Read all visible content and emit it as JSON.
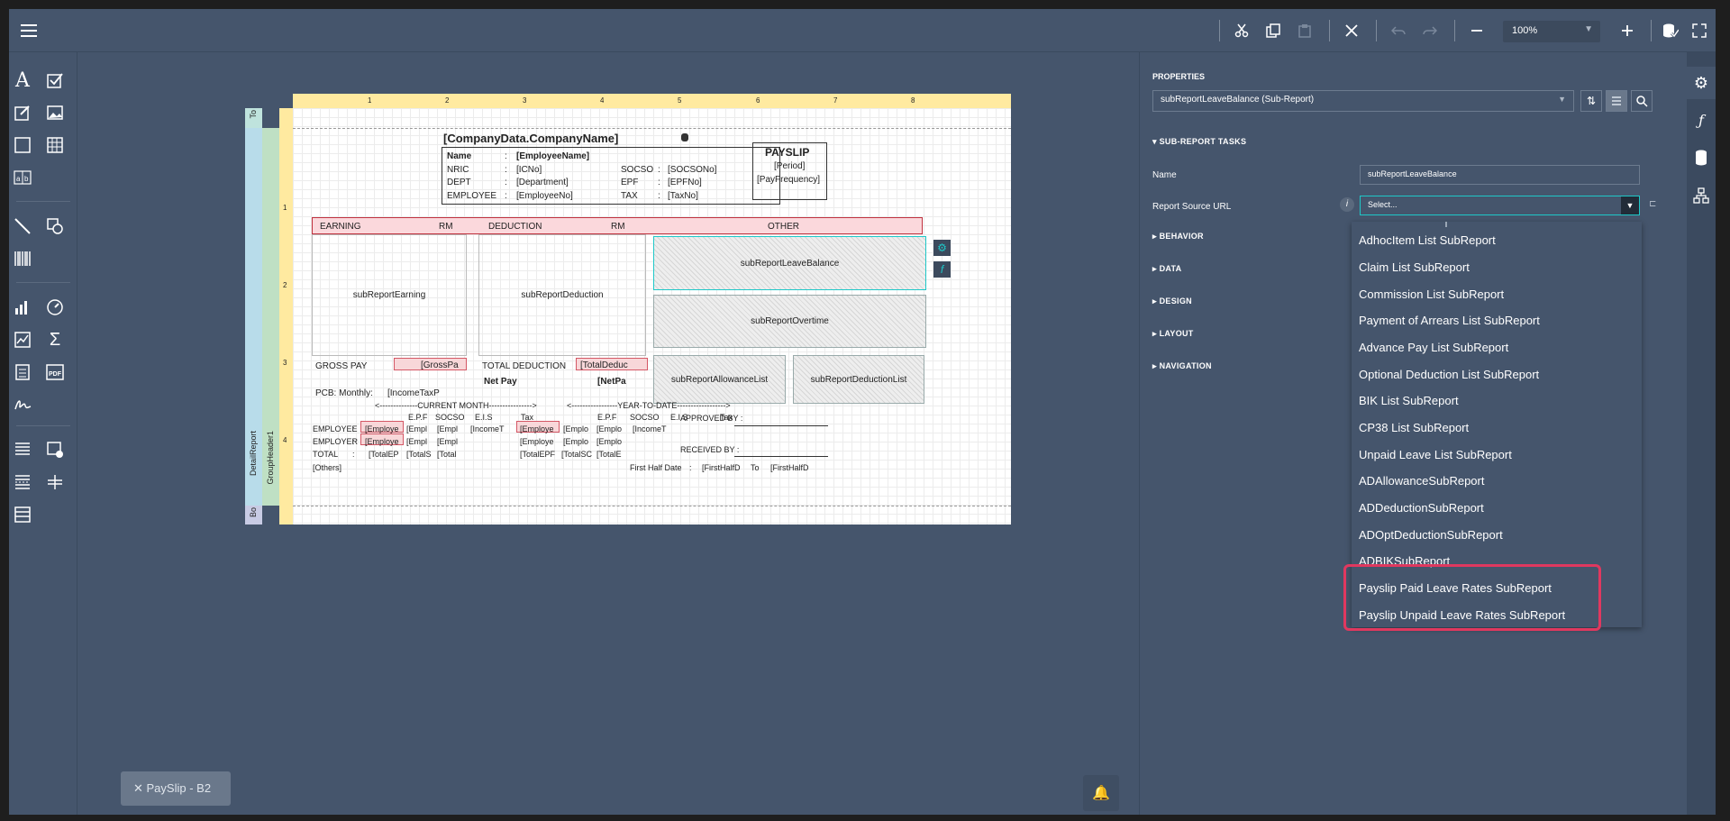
{
  "toolbar": {
    "zoom": "100%"
  },
  "report": {
    "company": "[CompanyData.CompanyName]",
    "payslip_title": "PAYSLIP",
    "period": "[Period]",
    "pay_frequency": "[PayFrequency]",
    "info_rows": [
      {
        "label": "Name",
        "colon": ":",
        "value": "[EmployeeName]"
      },
      {
        "label": "NRIC",
        "colon": ":",
        "value": "[ICNo]"
      },
      {
        "label": "DEPT",
        "colon": ":",
        "value": "[Department]"
      },
      {
        "label": "EMPLOYEE",
        "colon": ":",
        "value": "[EmployeeNo]"
      }
    ],
    "stat_rows": [
      {
        "label": "SOCSO",
        "colon": ":",
        "value": "[SOCSONo]"
      },
      {
        "label": "EPF",
        "colon": ":",
        "value": "[EPFNo]"
      },
      {
        "label": "TAX",
        "colon": ":",
        "value": "[TaxNo]"
      }
    ],
    "headers": {
      "earning": "EARNING",
      "rm1": "RM",
      "deduction": "DEDUCTION",
      "rm2": "RM",
      "other": "OTHER"
    },
    "subreports": {
      "earning": "subReportEarning",
      "deduction": "subReportDeduction",
      "leave_balance": "subReportLeaveBalance",
      "overtime": "subReportOvertime",
      "allowance": "subReportAllowanceList",
      "deduction_list": "subReportDeductionList"
    },
    "gross_pay": "GROSS PAY",
    "gross_pay_field": "[GrossPa",
    "total_deduction": "TOTAL DEDUCTION",
    "total_deduction_field": "[TotalDeduc",
    "net_pay": "Net Pay",
    "net_pay_field": "[NetPa",
    "pcb_label": "PCB: Monthly:",
    "pcb_field": "[IncomeTaxP",
    "current_month": "<--------------CURRENT MONTH---------------->",
    "ytd": "<-----------------YEAR-TO-DATE------------------>",
    "cols": [
      "E.P.F",
      "SOCSO",
      "E.I.S",
      "Tax"
    ],
    "rows": [
      {
        "label": "EMPLOYEE",
        "colon": ":",
        "cells": [
          "[Employe",
          "[Empl",
          "[Empl",
          "[IncomeT",
          "[Employe",
          "[Emplo",
          "[Emplo",
          "[IncomeT"
        ]
      },
      {
        "label": "EMPLOYER",
        "colon": ":",
        "cells": [
          "[Employe",
          "[Empl",
          "[Empl",
          "",
          "[Employe",
          "[Emplo",
          "[Emplo",
          ""
        ]
      },
      {
        "label": "TOTAL",
        "colon": ":",
        "cells": [
          "[TotalEP",
          "[TotalS",
          "[Total",
          "",
          "[TotalEPF",
          "[TotalSC",
          "[TotalE",
          ""
        ]
      }
    ],
    "others": "[Others]",
    "approved": "APPROVED BY :",
    "received": "RECEIVED BY :",
    "first_half": "First Half Date",
    "first_half_colon": ":",
    "first_half_f1": "[FirstHalfD",
    "to": "To",
    "first_half_f2": "[FirstHalfD",
    "bands": {
      "top": "To",
      "detail": "DetailReport",
      "group": "GroupHeader1",
      "bottom": "Bo"
    },
    "ruler": [
      "1",
      "2",
      "3",
      "4",
      "5",
      "6",
      "7",
      "8"
    ],
    "vruler": [
      "1",
      "2",
      "3",
      "4"
    ]
  },
  "properties": {
    "title": "PROPERTIES",
    "selected": "subReportLeaveBalance (Sub-Report)",
    "section_tasks": "SUB-REPORT TASKS",
    "name_label": "Name",
    "name_value": "subReportLeaveBalance",
    "url_label": "Report Source URL",
    "url_placeholder": "Select...",
    "sections": [
      "BEHAVIOR",
      "DATA",
      "DESIGN",
      "LAYOUT",
      "NAVIGATION"
    ]
  },
  "dropdown": {
    "items": [
      "AdhocItem List SubReport",
      "Claim List SubReport",
      "Commission List SubReport",
      "Payment of Arrears List SubReport",
      "Advance Pay List SubReport",
      "Optional Deduction List SubReport",
      "BIK List SubReport",
      "CP38 List SubReport",
      "Unpaid Leave List SubReport",
      "ADAllowanceSubReport",
      "ADDeductionSubReport",
      "ADOptDeductionSubReport",
      "ADBIKSubReport",
      "Payslip Paid Leave Rates SubReport",
      "Payslip Unpaid Leave Rates SubReport"
    ]
  },
  "bottom_tab": "PaySlip - B2",
  "colors": {
    "accent": "#1ec8c8",
    "highlight": "#e0385f",
    "panel": "#45556c"
  }
}
